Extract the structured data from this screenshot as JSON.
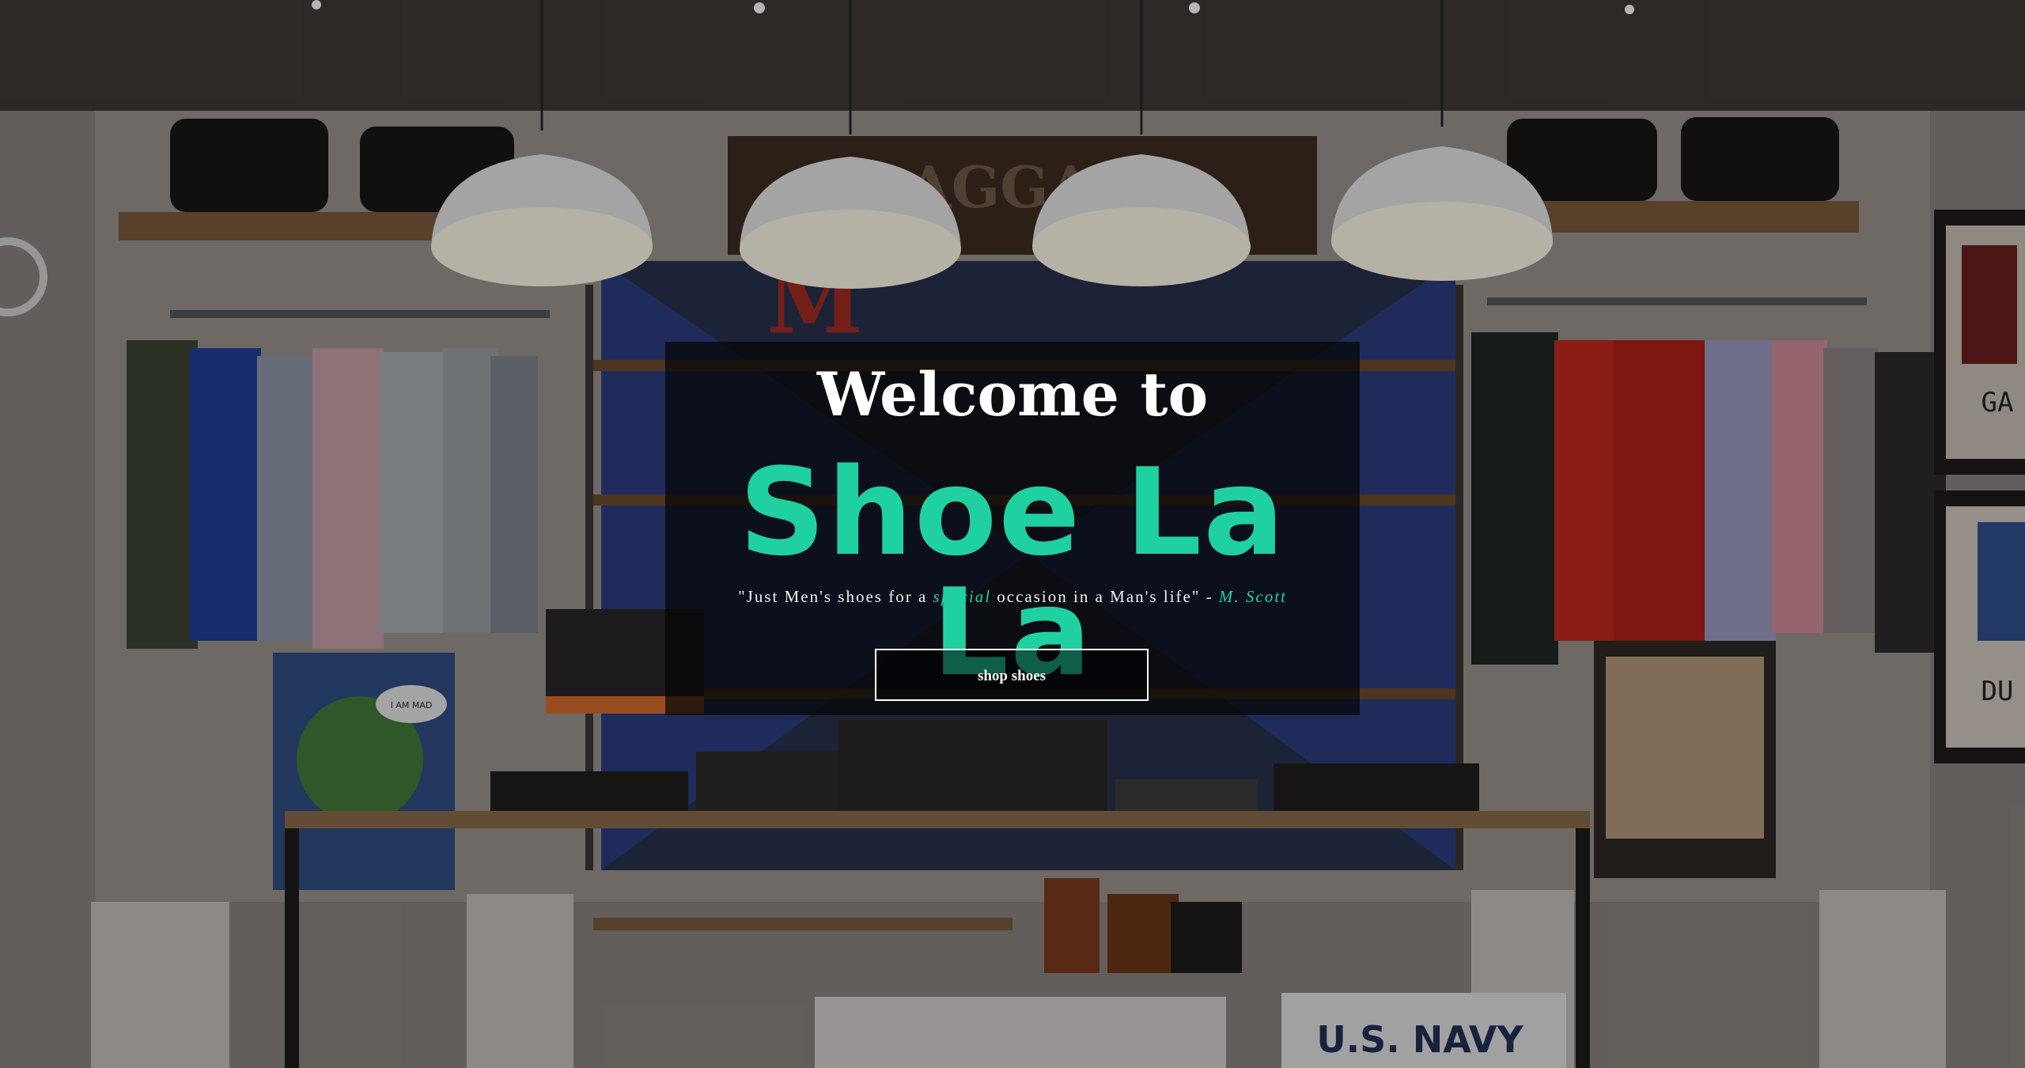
{
  "hero": {
    "welcome": "Welcome to",
    "brand": "Shoe La La",
    "quote_open": "\"Just Men's shoes for a ",
    "quote_emph": "special",
    "quote_mid": " occasion in a Man's life\" - ",
    "quote_author": "M. Scott",
    "cta_label": "shop shoes"
  },
  "background": {
    "sign_text": "BAGGAGE",
    "sign_letter": "M",
    "shirt_text": "U.S. NAVY",
    "poster_text_1": "GA",
    "poster_text_2": "DU",
    "poster_caption": "I AM MAD"
  },
  "colors": {
    "accent": "#1fd1a0",
    "overlay": "#050505",
    "text": "#ffffff"
  }
}
